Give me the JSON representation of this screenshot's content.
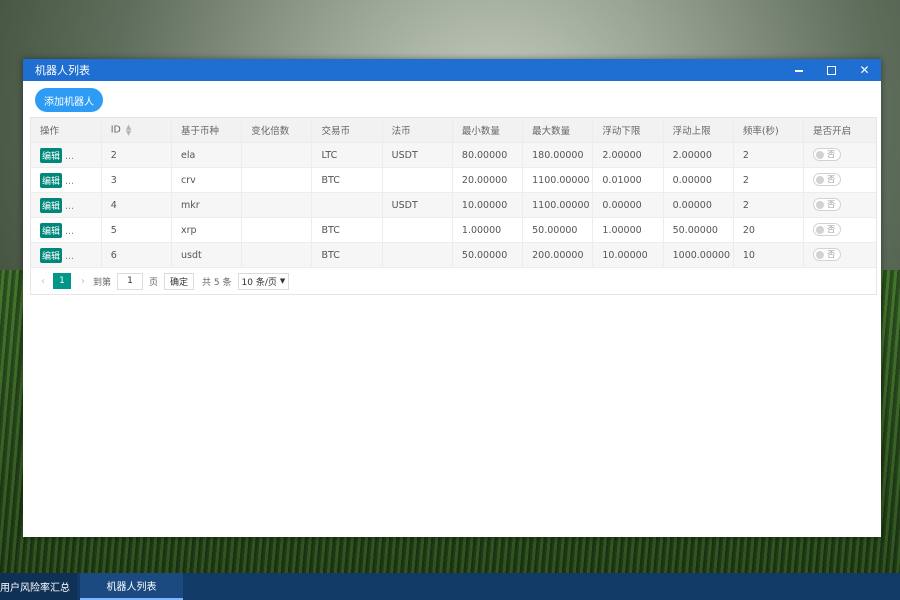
{
  "window": {
    "title": "机器人列表"
  },
  "toolbar": {
    "add_label": "添加机器人"
  },
  "table": {
    "headers": [
      "操作",
      "ID",
      "基于币种",
      "变化倍数",
      "交易币",
      "法币",
      "最小数量",
      "最大数量",
      "浮动下限",
      "浮动上限",
      "频率(秒)",
      "是否开启"
    ],
    "edit_label": "编辑",
    "more_label": "...",
    "switch_off_label": "否",
    "rows": [
      {
        "id": "2",
        "base": "ela",
        "mult": "",
        "trade": "LTC",
        "fiat": "USDT",
        "min": "80.00000",
        "max": "180.00000",
        "low": "2.00000",
        "high": "2.00000",
        "freq": "2"
      },
      {
        "id": "3",
        "base": "crv",
        "mult": "",
        "trade": "BTC",
        "fiat": "",
        "min": "20.00000",
        "max": "1100.00000",
        "low": "0.01000",
        "high": "0.00000",
        "freq": "2"
      },
      {
        "id": "4",
        "base": "mkr",
        "mult": "",
        "trade": "",
        "fiat": "USDT",
        "min": "10.00000",
        "max": "1100.00000",
        "low": "0.00000",
        "high": "0.00000",
        "freq": "2"
      },
      {
        "id": "5",
        "base": "xrp",
        "mult": "",
        "trade": "BTC",
        "fiat": "",
        "min": "1.00000",
        "max": "50.00000",
        "low": "1.00000",
        "high": "50.00000",
        "freq": "20"
      },
      {
        "id": "6",
        "base": "usdt",
        "mult": "",
        "trade": "BTC",
        "fiat": "",
        "min": "50.00000",
        "max": "200.00000",
        "low": "10.00000",
        "high": "1000.00000",
        "freq": "10"
      }
    ]
  },
  "pager": {
    "current": "1",
    "goto_label": "到第",
    "goto_value": "1",
    "page_unit": "页",
    "confirm_label": "确定",
    "total_label": "共 5 条",
    "page_size": "10 条/页"
  },
  "taskbar": {
    "items": [
      "用户风险率汇总",
      "机器人列表"
    ]
  },
  "icons": {
    "minimize": "minimize-icon",
    "maximize": "maximize-icon",
    "close": "close-icon"
  },
  "colors": {
    "titlebar": "#1e6fd1",
    "accent": "#2e9cf5",
    "edit": "#00877a",
    "pager_active": "#009688"
  }
}
